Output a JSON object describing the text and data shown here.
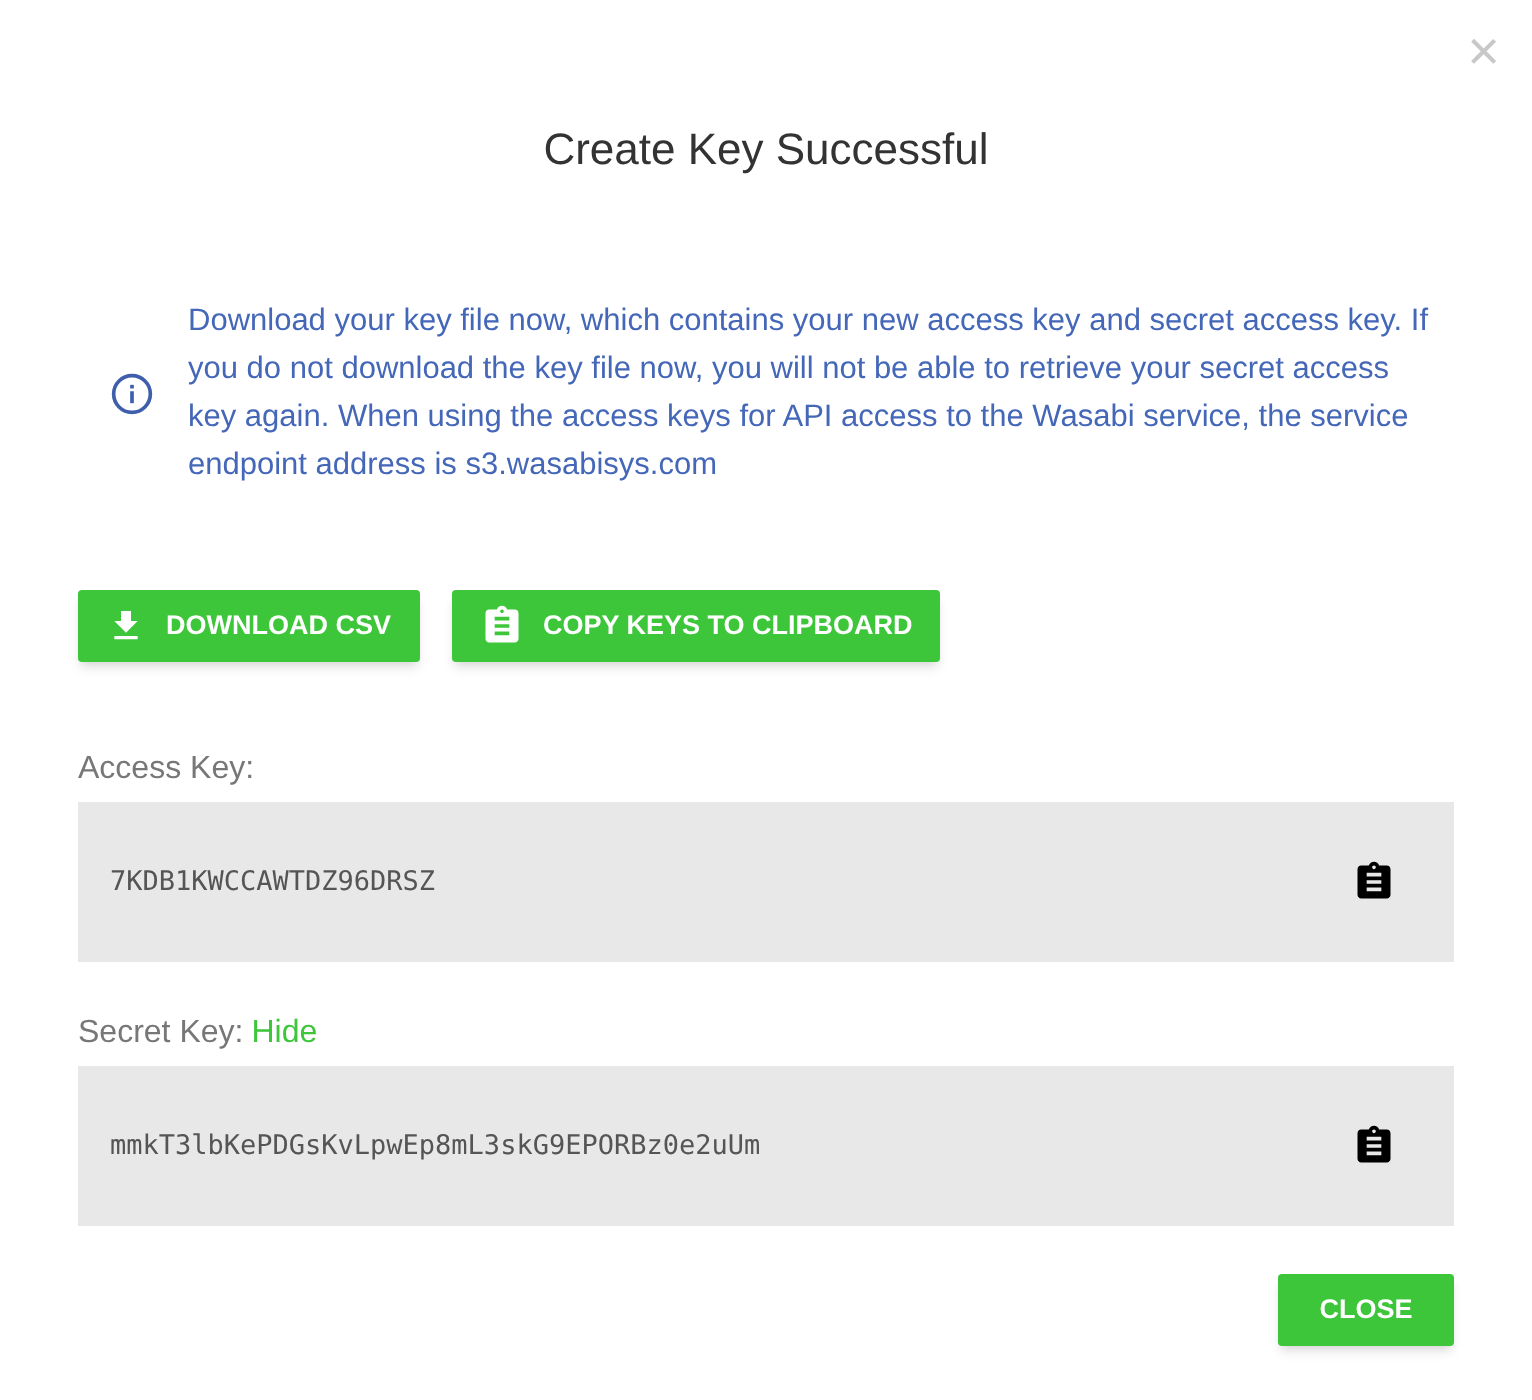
{
  "dialog": {
    "title": "Create Key Successful",
    "close": "×"
  },
  "notice": "Download your key file now, which contains your new access key and secret access key. If you do not download the key file now, you will not be able to retrieve your secret access key again. When using the access keys for API access to the Wasabi service, the service endpoint address is s3.wasabisys.com",
  "actions": [
    {
      "kind": "download",
      "label": "DOWNLOAD CSV"
    },
    {
      "kind": "copy",
      "label": "COPY KEYS TO CLIPBOARD"
    }
  ],
  "keys": [
    {
      "label": "Access Key:",
      "value": "7KDB1KWCCAWTDZ96DRSZ"
    },
    {
      "label": "Secret Key:",
      "toggle": "Hide",
      "value": "mmkT3lbKePDGsKvLpwEp8mL3skG9EPORBz0e2uUm"
    }
  ],
  "footer_button": "CLOSE"
}
